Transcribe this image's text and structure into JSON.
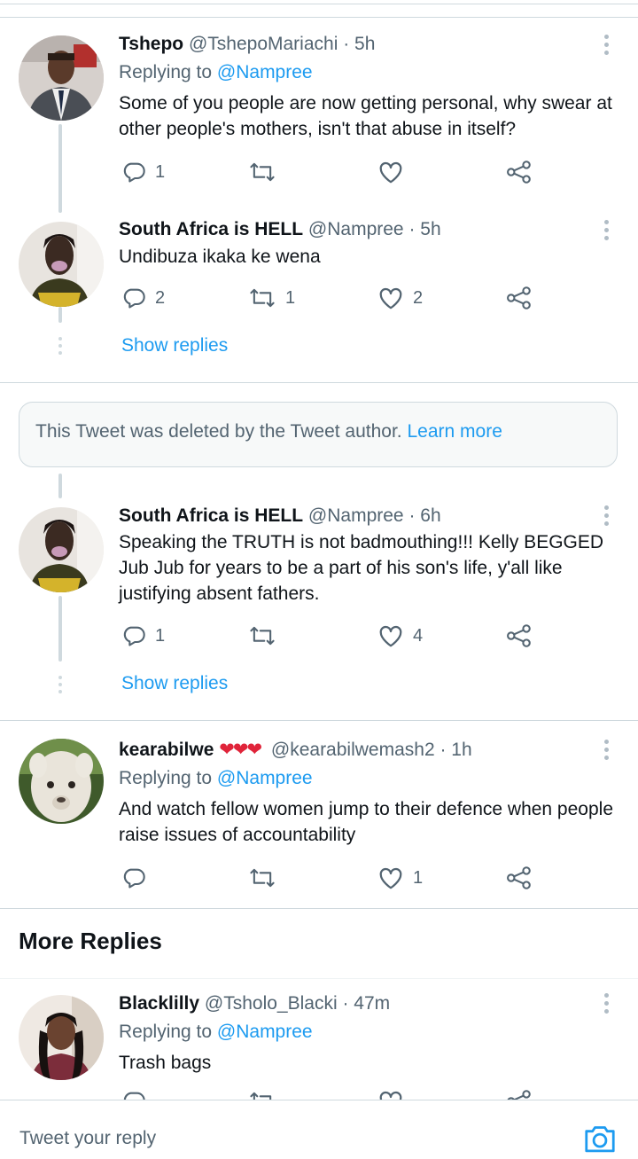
{
  "tweets": [
    {
      "name": "Tshepo",
      "handle": "@TshepoMariachi",
      "time": "· 5h",
      "replying_prefix": "Replying to ",
      "replying_to": "@Nampree",
      "text": "Some of you people are now getting personal, why swear at other people's mothers, isn't that abuse in itself?",
      "reply_count": "1",
      "retweet_count": "",
      "like_count": ""
    },
    {
      "name": "South Africa is HELL",
      "handle": "@Nampree",
      "time": "· 5h",
      "text": "Undibuza ikaka ke wena",
      "reply_count": "2",
      "retweet_count": "1",
      "like_count": "2"
    },
    {
      "name": "South Africa is HELL",
      "handle": "@Nampree",
      "time": "· 6h",
      "text": "Speaking the TRUTH is not badmouthing!!! Kelly BEGGED Jub Jub for years to be a part of his son's life, y'all like justifying absent fathers.",
      "reply_count": "1",
      "retweet_count": "",
      "like_count": "4"
    },
    {
      "name": "kearabilwe",
      "hearts": "❤❤❤",
      "handle": "@kearabilwemash2",
      "time": "· 1h",
      "replying_prefix": "Replying to ",
      "replying_to": "@Nampree",
      "text": "And watch fellow women jump to their defence when people raise issues of accountability",
      "reply_count": "",
      "retweet_count": "",
      "like_count": "1"
    },
    {
      "name": "Blacklilly",
      "handle": "@Tsholo_Blacki",
      "time": "· 47m",
      "replying_prefix": "Replying to ",
      "replying_to": "@Nampree",
      "text": "Trash bags"
    }
  ],
  "show_replies_label": "Show replies",
  "deleted_notice": {
    "text": "This Tweet was deleted by the Tweet author. ",
    "link": "Learn more"
  },
  "more_replies_title": "More Replies",
  "reply_placeholder": "Tweet your reply",
  "icons": {
    "reply": "reply-icon",
    "retweet": "retweet-icon",
    "like": "heart-icon",
    "share": "share-icon",
    "more": "more-icon",
    "camera": "camera-icon"
  },
  "colors": {
    "link": "#1d9bf0",
    "muted": "#536471",
    "heart_emoji": "#e0243a"
  }
}
